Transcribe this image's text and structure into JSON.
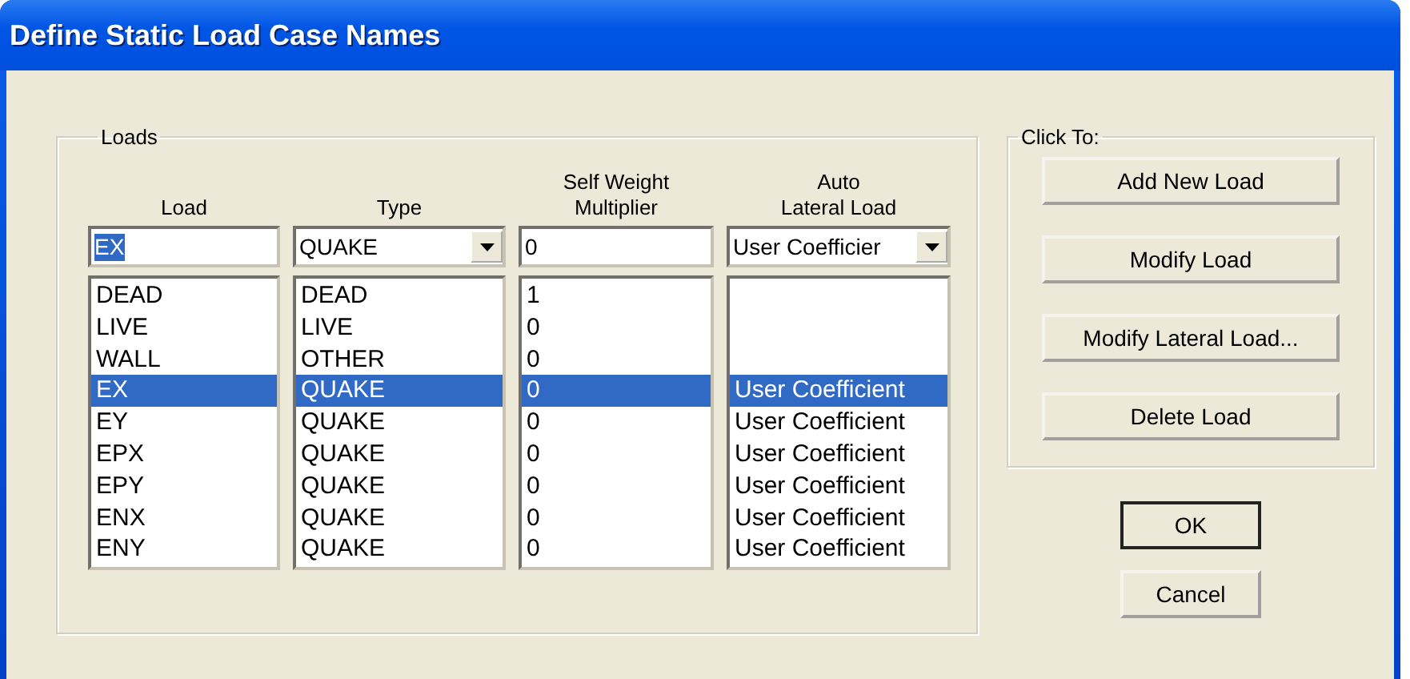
{
  "window": {
    "title": "Define Static Load Case Names"
  },
  "loads": {
    "label": "Loads",
    "columns": [
      {
        "heading_lines": [
          "Load"
        ]
      },
      {
        "heading_lines": [
          "Type"
        ]
      },
      {
        "heading_lines": [
          "Self Weight",
          "Multiplier"
        ]
      },
      {
        "heading_lines": [
          "Auto",
          "Lateral Load"
        ]
      }
    ],
    "edit": {
      "load": {
        "value": "EX",
        "highlighted": true
      },
      "type": {
        "value": "QUAKE"
      },
      "multiplier": {
        "value": "0"
      },
      "lateral": {
        "value": "User Coefficier"
      }
    },
    "rows": [
      {
        "load": "DEAD",
        "type": "DEAD",
        "multiplier": "1",
        "selected": false
      },
      {
        "load": "LIVE",
        "type": "LIVE",
        "multiplier": "0",
        "selected": false
      },
      {
        "load": "WALL",
        "type": "OTHER",
        "multiplier": "0",
        "selected": false
      },
      {
        "load": "EX",
        "type": "QUAKE",
        "multiplier": "0",
        "lateral": "User Coefficient",
        "selected": true
      },
      {
        "load": "EY",
        "type": "QUAKE",
        "multiplier": "0",
        "lateral": "User Coefficient",
        "selected": false
      },
      {
        "load": "EPX",
        "type": "QUAKE",
        "multiplier": "0",
        "lateral": "User Coefficient",
        "selected": false
      },
      {
        "load": "EPY",
        "type": "QUAKE",
        "multiplier": "0",
        "lateral": "User Coefficient",
        "selected": false
      },
      {
        "load": "ENX",
        "type": "QUAKE",
        "multiplier": "0",
        "lateral": "User Coefficient",
        "selected": false
      },
      {
        "load": "ENY",
        "type": "QUAKE",
        "multiplier": "0",
        "lateral": "User Coefficient",
        "selected": false
      }
    ]
  },
  "click_to": {
    "label": "Click To:",
    "buttons": [
      "Add New Load",
      "Modify Load",
      "Modify Lateral Load...",
      "Delete Load"
    ]
  },
  "dialog_buttons": [
    {
      "label": "OK",
      "default": true
    },
    {
      "label": "Cancel",
      "default": false
    }
  ]
}
